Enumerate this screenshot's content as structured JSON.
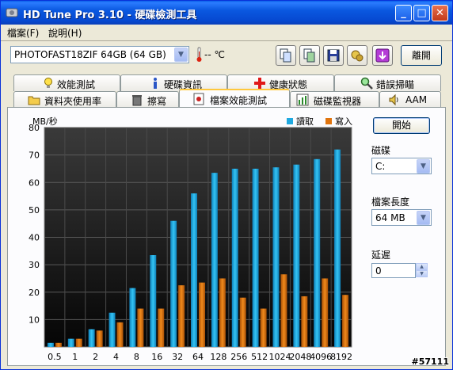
{
  "window": {
    "title": "HD Tune Pro 3.10 - 硬碟檢測工具",
    "minimize_glyph": "_",
    "maximize_glyph": "□",
    "close_glyph": "✕"
  },
  "menu": [
    {
      "label": "檔案(F)"
    },
    {
      "label": "說明(H)"
    }
  ],
  "toolbar": {
    "drive": "PHOTOFAST18ZIF 64GB (64 GB)",
    "temperature": "-- ℃",
    "exit_label": "離開",
    "icons": [
      "copy-info-icon",
      "copy-screenshot-icon",
      "save-icon",
      "options-icon",
      "download-icon"
    ]
  },
  "tabs": {
    "row1": [
      "效能測試",
      "硬碟資訊",
      "健康狀態",
      "錯誤掃瞄"
    ],
    "row2": [
      "資料夾使用率",
      "擦寫",
      "檔案效能測試",
      "磁碟監視器",
      "AAM"
    ],
    "active": "檔案效能測試"
  },
  "side": {
    "start_label": "開始",
    "disk_label": "磁碟",
    "disk_value": "C:",
    "file_length_label": "檔案長度",
    "file_length_value": "64 MB",
    "delay_label": "延遲",
    "delay_value": "0"
  },
  "chart_data": {
    "type": "bar",
    "ylabel": "MB/秒",
    "ylim": [
      0,
      80
    ],
    "yticks": [
      10,
      20,
      30,
      40,
      50,
      60,
      70,
      80
    ],
    "categories": [
      "0.5",
      "1",
      "2",
      "4",
      "8",
      "16",
      "32",
      "64",
      "128",
      "256",
      "512",
      "1024",
      "2048",
      "4096",
      "8192"
    ],
    "series": [
      {
        "name": "讀取",
        "color": "#1fa9e0",
        "values": [
          1.5,
          3,
          6.5,
          12.5,
          21.5,
          33.5,
          46,
          56,
          63.5,
          65,
          65,
          65.5,
          66.5,
          68.5,
          72
        ]
      },
      {
        "name": "寫入",
        "color": "#e0740e",
        "values": [
          1.5,
          3,
          6,
          9,
          14,
          14,
          22.5,
          23.5,
          25,
          18,
          14,
          26.5,
          18.5,
          25,
          19
        ]
      }
    ]
  },
  "watermark": "#57111"
}
